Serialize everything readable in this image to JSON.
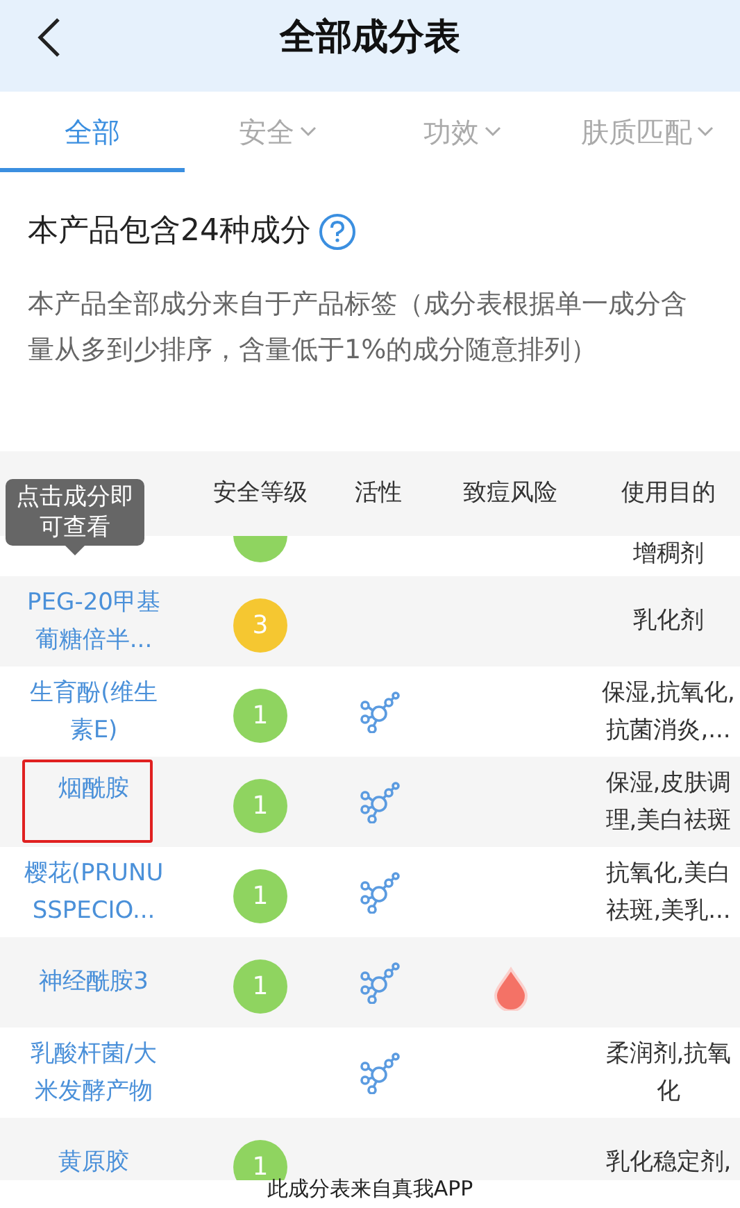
{
  "header": {
    "title": "全部成分表"
  },
  "tabs": [
    {
      "label": "全部",
      "selected": true,
      "dropdown": false
    },
    {
      "label": "安全",
      "selected": false,
      "dropdown": true
    },
    {
      "label": "功效",
      "selected": false,
      "dropdown": true
    },
    {
      "label": "肤质匹配",
      "selected": false,
      "dropdown": true
    }
  ],
  "summary": {
    "title": "本产品包含24种成分",
    "description": "本产品全部成分来自于产品标签（成分表根据单一成分含量从多到少排序，含量低于1%的成分随意排列）"
  },
  "table": {
    "columns": [
      "安全等级",
      "活性",
      "致痘风险",
      "使用目的"
    ],
    "tooltip": "点击成分即可查看",
    "rows": [
      {
        "name": "",
        "safety": "",
        "color": "#8fd460",
        "active": false,
        "acne_risk": false,
        "purpose": "增稠剂",
        "highlighted": false
      },
      {
        "name": "PEG-20甲基葡糖倍半...",
        "safety": "3",
        "color": "#f5c731",
        "active": false,
        "acne_risk": false,
        "purpose": "乳化剂",
        "highlighted": false
      },
      {
        "name": "生育酚(维生素E)",
        "safety": "1",
        "color": "#8fd460",
        "active": true,
        "acne_risk": false,
        "purpose": "保湿,抗氧化,抗菌消炎,...",
        "highlighted": false
      },
      {
        "name": "烟酰胺",
        "safety": "1",
        "color": "#8fd460",
        "active": true,
        "acne_risk": false,
        "purpose": "保湿,皮肤调理,美白祛斑",
        "highlighted": true
      },
      {
        "name": "樱花(PRUNUSSPECIO...",
        "safety": "1",
        "color": "#8fd460",
        "active": true,
        "acne_risk": false,
        "purpose": "抗氧化,美白祛斑,美乳...",
        "highlighted": false
      },
      {
        "name": "神经酰胺3",
        "safety": "1",
        "color": "#8fd460",
        "active": true,
        "acne_risk": true,
        "purpose": "",
        "highlighted": false
      },
      {
        "name": "乳酸杆菌/大米发酵产物",
        "safety": "",
        "active": true,
        "acne_risk": false,
        "purpose": "柔润剂,抗氧化",
        "highlighted": false
      },
      {
        "name": "黄原胶",
        "safety": "1",
        "color": "#8fd460",
        "active": false,
        "acne_risk": false,
        "purpose": "乳化稳定剂,",
        "highlighted": false
      }
    ]
  },
  "footer": {
    "text": "此成分表来自真我APP"
  }
}
